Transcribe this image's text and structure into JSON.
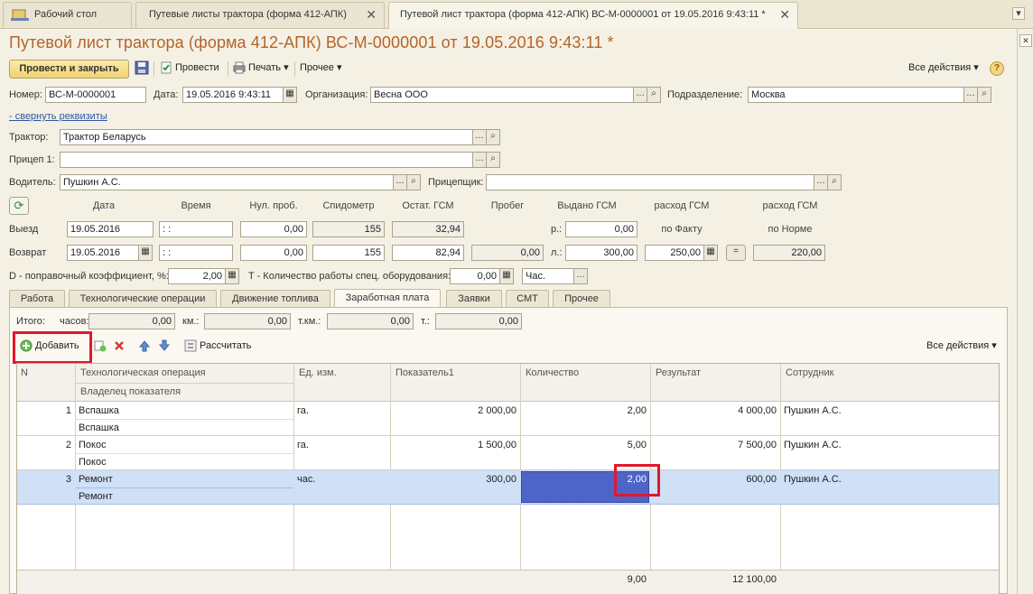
{
  "tabs": [
    {
      "label": "Рабочий стол"
    },
    {
      "label": "Путевые листы трактора (форма 412-АПК)"
    },
    {
      "label": "Путевой лист трактора (форма 412-АПК) ВС-М-0000001 от 19.05.2016 9:43:11 *"
    }
  ],
  "title": "Путевой лист трактора (форма 412-АПК) ВС-М-0000001 от 19.05.2016 9:43:11 *",
  "toolbar": {
    "post_close": "Провести и закрыть",
    "post": "Провести",
    "print": "Печать",
    "other": "Прочее",
    "all_actions": "Все действия",
    "help": "?"
  },
  "header": {
    "number_label": "Номер:",
    "number": "ВС-М-0000001",
    "date_label": "Дата:",
    "date": "19.05.2016  9:43:11",
    "org_label": "Организация:",
    "org": "Весна ООО",
    "dept_label": "Подразделение:",
    "dept": "Москва",
    "collapse_link": "- свернуть реквизиты"
  },
  "details": {
    "tractor_label": "Трактор:",
    "tractor": "Трактор Беларусь",
    "trailer_label": "Прицеп 1:",
    "trailer": "",
    "driver_label": "Водитель:",
    "driver": "Пушкин А.С.",
    "hitcher_label": "Прицепщик:",
    "hitcher": ""
  },
  "fuel": {
    "headers": {
      "date": "Дата",
      "time": "Время",
      "zero_run": "Нул. проб.",
      "odometer": "Спидометр",
      "fuel_left": "Остат. ГСМ",
      "mileage": "Пробег",
      "issued": "Выдано ГСМ",
      "fact": "расход ГСМ",
      "norm": "расход ГСМ",
      "fact_sub": "по Факту",
      "norm_sub": "по Норме"
    },
    "departure": {
      "label": "Выезд",
      "date": "19.05.2016",
      "time": " :  :",
      "zero_run": "0,00",
      "odometer": "155",
      "fuel_left": "32,94",
      "unit": "р.:",
      "issued": "0,00"
    },
    "return": {
      "label": "Возврат",
      "date": "19.05.2016",
      "time": " :  :",
      "zero_run": "0,00",
      "odometer": "155",
      "fuel_left": "82,94",
      "mileage": "0,00",
      "unit": "л.:",
      "issued": "300,00",
      "fact": "250,00",
      "eq": "=",
      "norm": "220,00"
    },
    "coef_label": "D - поправочный коэффициент, %:",
    "coef": "2,00",
    "t_label": "T - Количество работы спец. оборудования:",
    "t_value": "0,00",
    "t_unit": "Час."
  },
  "inner_tabs": [
    {
      "label": "Работа"
    },
    {
      "label": "Технологические операции"
    },
    {
      "label": "Движение топлива"
    },
    {
      "label": "Заработная плата"
    },
    {
      "label": "Заявки"
    },
    {
      "label": "СМТ"
    },
    {
      "label": "Прочее"
    }
  ],
  "totals": {
    "label": "Итого:",
    "hours_label": "часов:",
    "hours": "0,00",
    "km_label": "км.:",
    "km": "0,00",
    "tkm_label": "т.км.:",
    "tkm": "0,00",
    "t_label": "т.:",
    "t": "0,00"
  },
  "table_toolbar": {
    "add": "Добавить",
    "calculate": "Рассчитать",
    "all_actions": "Все действия"
  },
  "table": {
    "columns": {
      "n": "N",
      "operation": "Технологическая операция",
      "owner": "Владелец показателя",
      "unit": "Ед. изм.",
      "indicator": "Показатель1",
      "quantity": "Количество",
      "result": "Результат",
      "employee": "Сотрудник"
    },
    "rows": [
      {
        "n": "1",
        "operation": "Вспашка",
        "owner": "Вспашка",
        "unit": "га.",
        "indicator": "2 000,00",
        "quantity": "2,00",
        "result": "4 000,00",
        "employee": "Пушкин А.С."
      },
      {
        "n": "2",
        "operation": "Покос",
        "owner": "Покос",
        "unit": "га.",
        "indicator": "1 500,00",
        "quantity": "5,00",
        "result": "7 500,00",
        "employee": "Пушкин А.С."
      },
      {
        "n": "3",
        "operation": "Ремонт",
        "owner": "Ремонт",
        "unit": "час.",
        "indicator": "300,00",
        "quantity": "2,00",
        "result": "600,00",
        "employee": "Пушкин А.С."
      }
    ],
    "footer": {
      "quantity": "9,00",
      "result": "12 100,00"
    }
  },
  "colors": {
    "title": "#b5632a",
    "selected_row": "#cfe0f7",
    "active_cell": "#4f64c8",
    "highlight": "#e0182c"
  }
}
